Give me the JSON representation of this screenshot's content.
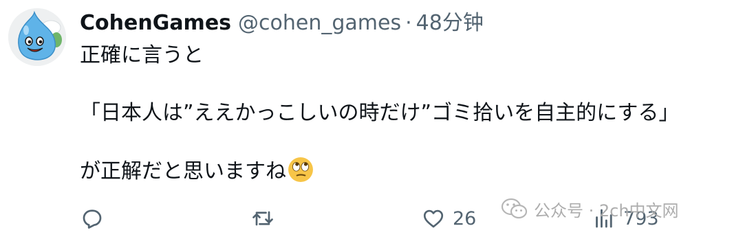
{
  "author": {
    "display_name": "CohenGames",
    "handle": "@cohen_games",
    "separator": "·",
    "time": "48分钟",
    "avatar_icon": "slime-mascot-avatar"
  },
  "tweet": {
    "line1": "正確に言うと",
    "line2": "「日本人は”ええかっこしいの時だけ”ゴミ拾いを自主的にする」",
    "line3": "が正解だと思いますね",
    "emoji": "face-with-rolling-eyes"
  },
  "actions": {
    "reply": {
      "icon": "reply-icon",
      "count": ""
    },
    "retweet": {
      "icon": "retweet-icon",
      "count": ""
    },
    "like": {
      "icon": "heart-icon",
      "count": "26"
    },
    "views": {
      "icon": "analytics-icon",
      "count": "793"
    }
  },
  "watermark": {
    "text": "公众号 · 2ch中文网",
    "icon": "wechat-icon"
  },
  "colors": {
    "text_primary": "#0f1419",
    "text_secondary": "#536471",
    "avatar_slime": "#5fb3e8",
    "emoji_face": "#f7c548"
  }
}
